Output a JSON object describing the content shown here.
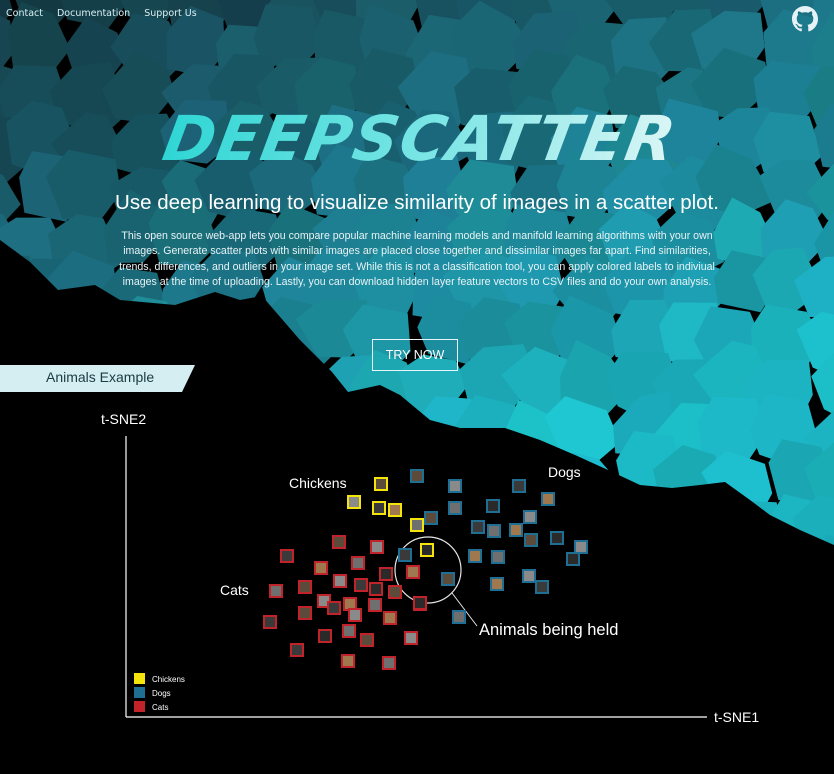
{
  "nav": {
    "contact": "Contact",
    "documentation": "Documentation",
    "support": "Support Us"
  },
  "github_icon": "github-icon",
  "logo_text": "DEEPSCATTER",
  "headline": "Use deep learning to visualize similarity of images in a scatter plot.",
  "description": "This open source web-app lets you compare popular machine learning models and manifold learning algorithms with your own images. Generate scatter plots with similar images are placed close together and dissimilar images far apart. Find similarities, trends, differences, and outliers in your image set. While this is not a classification tool, you can apply colored labels to indiviual images at the time of uploading. Lastly, you can download hidden layer feature vectors to CSV files and do your own analysis.",
  "cta": "TRY NOW",
  "example_label": "Animals Example",
  "colors": {
    "accent": "#1aa6b3",
    "chickens": "#f4e40b",
    "dogs": "#1f6f94",
    "cats": "#c0242a"
  },
  "chart_data": {
    "type": "scatter",
    "xlabel": "t-SNE1",
    "ylabel": "t-SNE2",
    "annotations": {
      "chickens": "Chickens",
      "dogs": "Dogs",
      "cats": "Cats",
      "held": "Animals being held"
    },
    "legend": {
      "placement": "bottom-left",
      "entries": [
        "Chickens",
        "Dogs",
        "Cats"
      ]
    },
    "series": [
      {
        "name": "Chickens",
        "points": [
          [
            381,
            484
          ],
          [
            354,
            502
          ],
          [
            379,
            508
          ],
          [
            395,
            510
          ],
          [
            417,
            525
          ],
          [
            427,
            550
          ]
        ]
      },
      {
        "name": "Dogs",
        "points": [
          [
            417,
            476
          ],
          [
            455,
            486
          ],
          [
            519,
            486
          ],
          [
            548,
            499
          ],
          [
            455,
            508
          ],
          [
            493,
            506
          ],
          [
            431,
            518
          ],
          [
            530,
            517
          ],
          [
            478,
            527
          ],
          [
            516,
            530
          ],
          [
            494,
            531
          ],
          [
            557,
            538
          ],
          [
            531,
            540
          ],
          [
            581,
            547
          ],
          [
            405,
            555
          ],
          [
            475,
            556
          ],
          [
            498,
            557
          ],
          [
            573,
            559
          ],
          [
            448,
            579
          ],
          [
            529,
            576
          ],
          [
            542,
            587
          ],
          [
            497,
            584
          ],
          [
            459,
            617
          ]
        ]
      },
      {
        "name": "Cats",
        "points": [
          [
            339,
            542
          ],
          [
            377,
            547
          ],
          [
            287,
            556
          ],
          [
            321,
            568
          ],
          [
            358,
            563
          ],
          [
            386,
            574
          ],
          [
            305,
            587
          ],
          [
            340,
            581
          ],
          [
            361,
            585
          ],
          [
            413,
            572
          ],
          [
            276,
            591
          ],
          [
            376,
            589
          ],
          [
            395,
            592
          ],
          [
            324,
            601
          ],
          [
            334,
            608
          ],
          [
            350,
            604
          ],
          [
            375,
            605
          ],
          [
            420,
            604
          ],
          [
            305,
            613
          ],
          [
            355,
            615
          ],
          [
            270,
            622
          ],
          [
            390,
            618
          ],
          [
            349,
            631
          ],
          [
            325,
            636
          ],
          [
            367,
            640
          ],
          [
            411,
            638
          ],
          [
            297,
            650
          ],
          [
            348,
            661
          ],
          [
            389,
            663
          ],
          [
            420,
            603
          ]
        ]
      }
    ]
  }
}
